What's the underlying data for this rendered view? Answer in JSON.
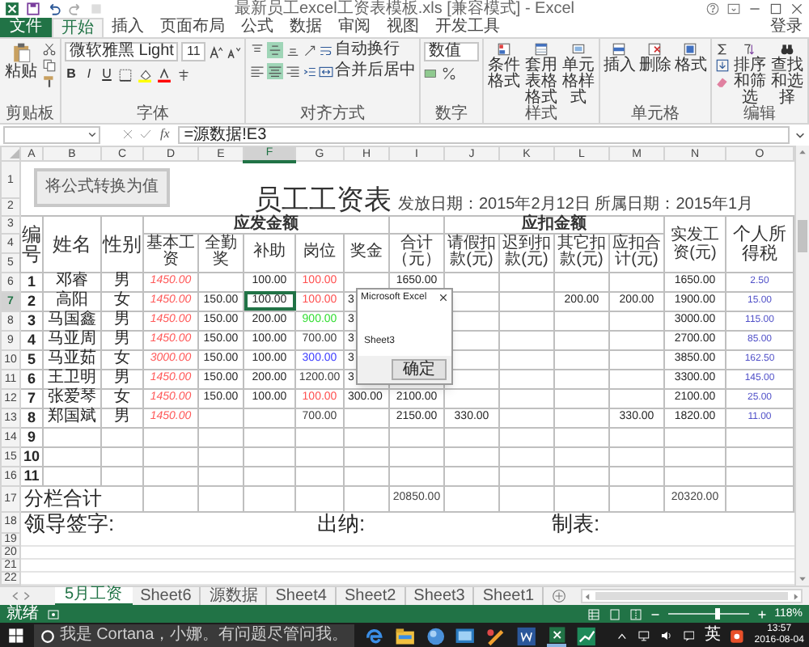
{
  "window": {
    "title": "最新员工excel工资表模板.xls  [兼容模式] - Excel"
  },
  "ribbon_tabs": [
    {
      "label": "文件",
      "kind": "file",
      "selected": false
    },
    {
      "label": "开始",
      "kind": "tab",
      "selected": true
    },
    {
      "label": "插入",
      "kind": "tab",
      "selected": false
    },
    {
      "label": "页面布局",
      "kind": "tab",
      "selected": false
    },
    {
      "label": "公式",
      "kind": "tab",
      "selected": false
    },
    {
      "label": "数据",
      "kind": "tab",
      "selected": false
    },
    {
      "label": "审阅",
      "kind": "tab",
      "selected": false
    },
    {
      "label": "视图",
      "kind": "tab",
      "selected": false
    },
    {
      "label": "开发工具",
      "kind": "tab",
      "selected": false
    }
  ],
  "sign_in": "登录",
  "ribbon": {
    "clipboard": {
      "paste": "粘贴",
      "label": "剪贴板"
    },
    "font": {
      "name": "微软雅黑 Light",
      "size": "11",
      "styles": [
        "B",
        "I",
        "U"
      ],
      "label": "字体"
    },
    "alignment": {
      "vertical": [
        {
          "selected": false
        },
        {
          "selected": true
        },
        {
          "selected": false
        }
      ],
      "horizontal": [
        {
          "selected": false
        },
        {
          "selected": true
        },
        {
          "selected": false
        }
      ],
      "wrap": "自动换行",
      "merge": "合并后居中",
      "label": "对齐方式"
    },
    "number": {
      "format": "数值",
      "label": "数字"
    },
    "styles": {
      "buttons": [
        "条件格式",
        "套用表格格式",
        "单元格样式"
      ],
      "label": "样式"
    },
    "cells": {
      "buttons": [
        "插入",
        "删除",
        "格式"
      ],
      "label": "单元格"
    },
    "editing": {
      "buttons": [
        "排序和筛选",
        "查找和选择"
      ],
      "label": "编辑"
    }
  },
  "formula_bar": {
    "fx": "fx",
    "formula": "=源数据!E3"
  },
  "sheet": {
    "columns": [
      {
        "label": "A",
        "selected": false
      },
      {
        "label": "B",
        "selected": false
      },
      {
        "label": "C",
        "selected": false
      },
      {
        "label": "D",
        "selected": false
      },
      {
        "label": "E",
        "selected": false
      },
      {
        "label": "F",
        "selected": true
      },
      {
        "label": "G",
        "selected": false
      },
      {
        "label": "H",
        "selected": false
      },
      {
        "label": "I",
        "selected": false
      },
      {
        "label": "J",
        "selected": false
      },
      {
        "label": "K",
        "selected": false
      },
      {
        "label": "L",
        "selected": false
      },
      {
        "label": "M",
        "selected": false
      },
      {
        "label": "N",
        "selected": false
      },
      {
        "label": "O",
        "selected": false
      }
    ],
    "banner": {
      "row_headers": [
        "1",
        "2"
      ],
      "button": "将公式转换为值",
      "title": "员工工资表",
      "dates": "发放日期：2015年2月12日 所属日期：2015年1月"
    },
    "header": {
      "row_headers": [
        "3",
        "4",
        "5"
      ],
      "income_group": "应发金额",
      "deduction_group": "应扣金额",
      "labels": [
        "编号",
        "姓名",
        "性别",
        "基本工资",
        "全勤奖",
        "补助",
        "岗位",
        "奖金",
        "合计（元）",
        "请假扣款(元)",
        "迟到扣款(元)",
        "其它扣款(元)",
        "应扣合计(元)",
        "实发工资(元)",
        "个人所得税"
      ]
    },
    "rows": [
      {
        "header": "6",
        "selected": false,
        "color": "#ff5050",
        "cells": [
          "1",
          "邓睿",
          "男",
          "1450.00",
          null,
          "100.00",
          "100.00",
          null,
          "1650.00",
          null,
          null,
          null,
          null,
          "1650.00",
          "2.50"
        ]
      },
      {
        "header": "7",
        "selected": true,
        "color": "#ff5050",
        "cells": [
          "2",
          "高阳",
          "女",
          "1450.00",
          "150.00",
          "100.00",
          "100.00",
          "3",
          null,
          null,
          null,
          "200.00",
          "200.00",
          "1900.00",
          "15.00"
        ]
      },
      {
        "header": "8",
        "selected": false,
        "color": "#33dd33",
        "cells": [
          "3",
          "马国鑫",
          "男",
          "1450.00",
          "150.00",
          "200.00",
          "900.00",
          "3",
          null,
          null,
          null,
          null,
          null,
          "3000.00",
          "115.00"
        ]
      },
      {
        "header": "9",
        "selected": false,
        "color": "#404040",
        "cells": [
          "4",
          "马亚周",
          "男",
          "1450.00",
          "150.00",
          "100.00",
          "700.00",
          "3",
          null,
          null,
          null,
          null,
          null,
          "2700.00",
          "85.00"
        ]
      },
      {
        "header": "10",
        "selected": false,
        "color": "#4040ff",
        "cells": [
          "5",
          "马亚茹",
          "女",
          "3000.00",
          "150.00",
          "100.00",
          "300.00",
          "3",
          null,
          null,
          null,
          null,
          null,
          "3850.00",
          "162.50"
        ]
      },
      {
        "header": "11",
        "selected": false,
        "color": "#404040",
        "cells": [
          "6",
          "王卫明",
          "男",
          "1450.00",
          "150.00",
          "200.00",
          "1200.00",
          "3",
          null,
          null,
          null,
          null,
          null,
          "3300.00",
          "145.00"
        ]
      },
      {
        "header": "12",
        "selected": false,
        "color": "#ff5050",
        "cells": [
          "7",
          "张爱琴",
          "女",
          "1450.00",
          "150.00",
          "100.00",
          "100.00",
          "300.00",
          "2100.00",
          null,
          null,
          null,
          null,
          "2100.00",
          "25.00"
        ]
      },
      {
        "header": "13",
        "selected": false,
        "color": "#404040",
        "cells": [
          "8",
          "郑国斌",
          "男",
          "1450.00",
          null,
          null,
          "700.00",
          null,
          "2150.00",
          "330.00",
          null,
          null,
          "330.00",
          "1820.00",
          "11.00"
        ]
      },
      {
        "header": "14",
        "selected": false,
        "cells": [
          "9",
          null,
          null,
          null,
          null,
          null,
          null,
          null,
          null,
          null,
          null,
          null,
          null,
          null,
          null
        ]
      },
      {
        "header": "15",
        "selected": false,
        "cells": [
          "10",
          null,
          null,
          null,
          null,
          null,
          null,
          null,
          null,
          null,
          null,
          null,
          null,
          null,
          null
        ]
      },
      {
        "header": "16",
        "selected": false,
        "cells": [
          "11",
          null,
          null,
          null,
          null,
          null,
          null,
          null,
          null,
          null,
          null,
          null,
          null,
          null,
          null
        ]
      }
    ],
    "total": {
      "header": "17",
      "label": "分栏合计",
      "cells": [
        null,
        null,
        null,
        null,
        null,
        "20850.00",
        null,
        null,
        null,
        null,
        "20320.00",
        null
      ]
    },
    "signatures": {
      "header": "18",
      "items": [
        "领导签字:",
        "出纳:",
        "制表:"
      ]
    },
    "empty_rows": [
      "19",
      "20",
      "21",
      "22"
    ],
    "dialog": {
      "title": "Microsoft Excel",
      "message": "Sheet3",
      "button": "确定"
    }
  },
  "sheet_tabs": [
    {
      "label": "5月工资",
      "selected": true
    },
    {
      "label": "Sheet6",
      "selected": false
    },
    {
      "label": "源数据",
      "selected": false
    },
    {
      "label": "Sheet4",
      "selected": false
    },
    {
      "label": "Sheet2",
      "selected": false
    },
    {
      "label": "Sheet3",
      "selected": false
    },
    {
      "label": "Sheet1",
      "selected": false
    }
  ],
  "status_bar": {
    "status": "就绪",
    "zoom": {
      "level": 0.6,
      "reading": "118%"
    }
  },
  "taskbar": {
    "search": "我是 Cortana，小娜。有问题尽管问我。",
    "ime": "英",
    "time": "13:57",
    "date": "2016-08-04"
  }
}
